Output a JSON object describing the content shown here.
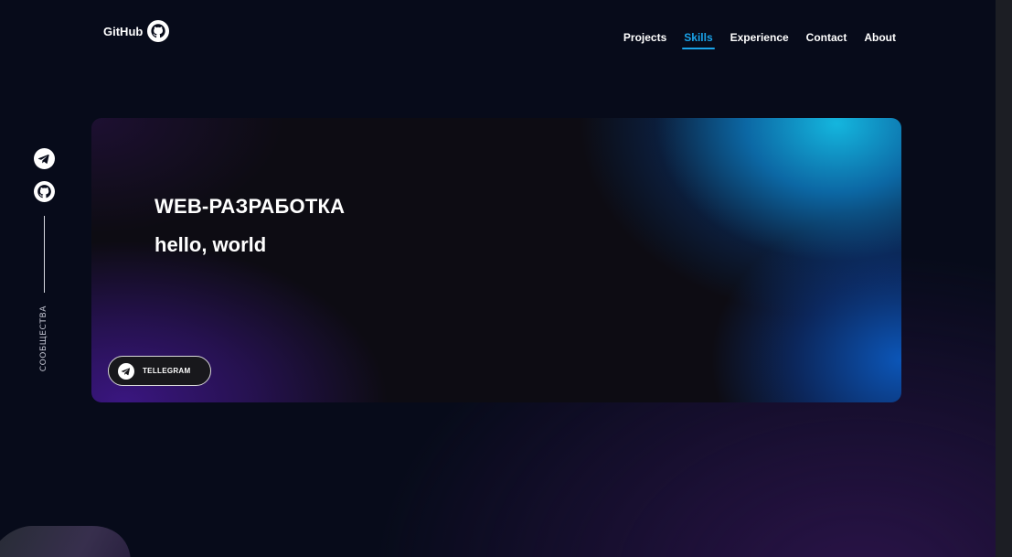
{
  "header": {
    "logo_text": "GitHub",
    "logo_icon": "github-icon",
    "nav": [
      {
        "label": "Projects",
        "active": false
      },
      {
        "label": "Skills",
        "active": true
      },
      {
        "label": "Experience",
        "active": false
      },
      {
        "label": "Contact",
        "active": false
      },
      {
        "label": "About",
        "active": false
      }
    ]
  },
  "side": {
    "icons": [
      "telegram-icon",
      "github-icon"
    ],
    "label": "СООБЩЕСТВА"
  },
  "hero": {
    "title": "WEB-РАЗРАБОТКА",
    "subtitle": "hello, world",
    "button_label": "TELLEGRAM",
    "button_icon": "telegram-icon"
  },
  "colors": {
    "background": "#070b1a",
    "accent": "#1aa3e8",
    "text": "#ffffff"
  }
}
